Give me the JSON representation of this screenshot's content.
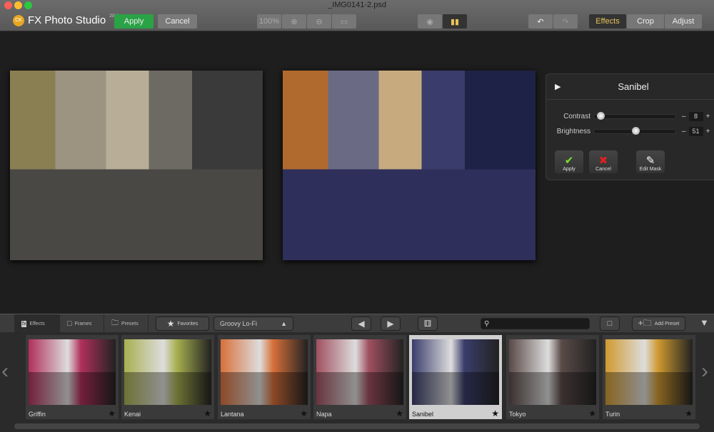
{
  "window": {
    "title": "_IMG0141-2.psd"
  },
  "toolbar": {
    "app_name": "FX Photo Studio",
    "app_year": "2016",
    "logo_badge": "CK",
    "apply": "Apply",
    "cancel": "Cancel",
    "zoom": "100%",
    "modes": [
      "Effects",
      "Crop",
      "Adjust"
    ],
    "active_mode": "Effects"
  },
  "panel": {
    "title": "Sanibel",
    "sliders": [
      {
        "label": "Contrast",
        "value": "8",
        "fraction": 0.08
      },
      {
        "label": "Brightness",
        "value": "51",
        "fraction": 0.51
      }
    ],
    "apply": "Apply",
    "cancel": "Cancel",
    "edit_mask": "Edit Mask"
  },
  "bottombar": {
    "tabs": [
      "Effects",
      "Frames",
      "Presets"
    ],
    "favorites": "Favorites",
    "category": "Groovy Lo-Fi",
    "search_placeholder": "",
    "add_preset": "Add Preset"
  },
  "thumbnails": [
    {
      "name": "Griffin",
      "color": "#b0305a"
    },
    {
      "name": "Kenai",
      "color": "#a8b050"
    },
    {
      "name": "Lantana",
      "color": "#d8703a"
    },
    {
      "name": "Napa",
      "color": "#a05060"
    },
    {
      "name": "Sanibel",
      "color": "#3a3d6b",
      "selected": true
    },
    {
      "name": "Tokyo",
      "color": "#5a4a48"
    },
    {
      "name": "Turin",
      "color": "#d09a30"
    }
  ],
  "colors": {
    "accent_green": "#2aa246",
    "active_mode_text": "#e8c35a"
  }
}
